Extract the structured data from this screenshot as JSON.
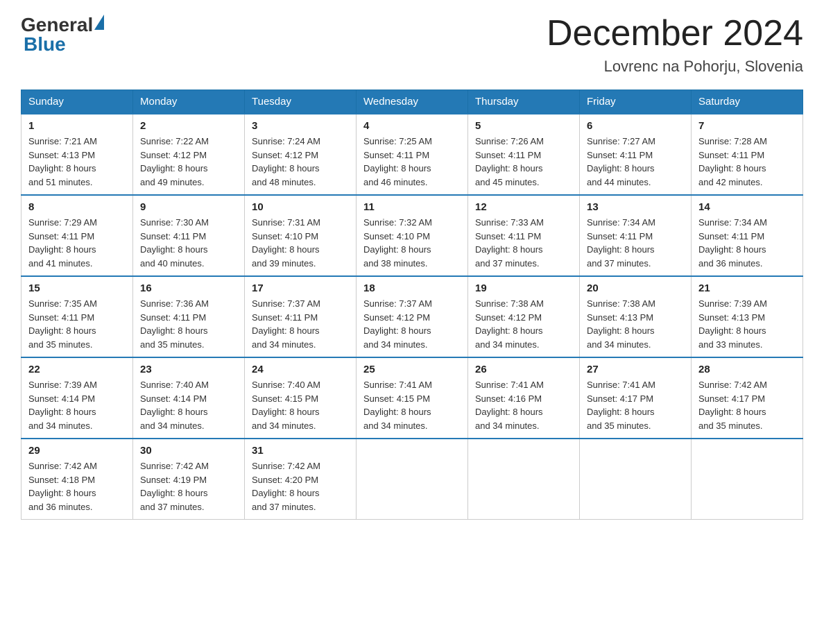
{
  "header": {
    "logo_general": "General",
    "logo_blue": "Blue",
    "title": "December 2024",
    "subtitle": "Lovrenc na Pohorju, Slovenia"
  },
  "days_of_week": [
    "Sunday",
    "Monday",
    "Tuesday",
    "Wednesday",
    "Thursday",
    "Friday",
    "Saturday"
  ],
  "weeks": [
    [
      {
        "day": "1",
        "sunrise": "7:21 AM",
        "sunset": "4:13 PM",
        "daylight": "8 hours and 51 minutes."
      },
      {
        "day": "2",
        "sunrise": "7:22 AM",
        "sunset": "4:12 PM",
        "daylight": "8 hours and 49 minutes."
      },
      {
        "day": "3",
        "sunrise": "7:24 AM",
        "sunset": "4:12 PM",
        "daylight": "8 hours and 48 minutes."
      },
      {
        "day": "4",
        "sunrise": "7:25 AM",
        "sunset": "4:11 PM",
        "daylight": "8 hours and 46 minutes."
      },
      {
        "day": "5",
        "sunrise": "7:26 AM",
        "sunset": "4:11 PM",
        "daylight": "8 hours and 45 minutes."
      },
      {
        "day": "6",
        "sunrise": "7:27 AM",
        "sunset": "4:11 PM",
        "daylight": "8 hours and 44 minutes."
      },
      {
        "day": "7",
        "sunrise": "7:28 AM",
        "sunset": "4:11 PM",
        "daylight": "8 hours and 42 minutes."
      }
    ],
    [
      {
        "day": "8",
        "sunrise": "7:29 AM",
        "sunset": "4:11 PM",
        "daylight": "8 hours and 41 minutes."
      },
      {
        "day": "9",
        "sunrise": "7:30 AM",
        "sunset": "4:11 PM",
        "daylight": "8 hours and 40 minutes."
      },
      {
        "day": "10",
        "sunrise": "7:31 AM",
        "sunset": "4:10 PM",
        "daylight": "8 hours and 39 minutes."
      },
      {
        "day": "11",
        "sunrise": "7:32 AM",
        "sunset": "4:10 PM",
        "daylight": "8 hours and 38 minutes."
      },
      {
        "day": "12",
        "sunrise": "7:33 AM",
        "sunset": "4:11 PM",
        "daylight": "8 hours and 37 minutes."
      },
      {
        "day": "13",
        "sunrise": "7:34 AM",
        "sunset": "4:11 PM",
        "daylight": "8 hours and 37 minutes."
      },
      {
        "day": "14",
        "sunrise": "7:34 AM",
        "sunset": "4:11 PM",
        "daylight": "8 hours and 36 minutes."
      }
    ],
    [
      {
        "day": "15",
        "sunrise": "7:35 AM",
        "sunset": "4:11 PM",
        "daylight": "8 hours and 35 minutes."
      },
      {
        "day": "16",
        "sunrise": "7:36 AM",
        "sunset": "4:11 PM",
        "daylight": "8 hours and 35 minutes."
      },
      {
        "day": "17",
        "sunrise": "7:37 AM",
        "sunset": "4:11 PM",
        "daylight": "8 hours and 34 minutes."
      },
      {
        "day": "18",
        "sunrise": "7:37 AM",
        "sunset": "4:12 PM",
        "daylight": "8 hours and 34 minutes."
      },
      {
        "day": "19",
        "sunrise": "7:38 AM",
        "sunset": "4:12 PM",
        "daylight": "8 hours and 34 minutes."
      },
      {
        "day": "20",
        "sunrise": "7:38 AM",
        "sunset": "4:13 PM",
        "daylight": "8 hours and 34 minutes."
      },
      {
        "day": "21",
        "sunrise": "7:39 AM",
        "sunset": "4:13 PM",
        "daylight": "8 hours and 33 minutes."
      }
    ],
    [
      {
        "day": "22",
        "sunrise": "7:39 AM",
        "sunset": "4:14 PM",
        "daylight": "8 hours and 34 minutes."
      },
      {
        "day": "23",
        "sunrise": "7:40 AM",
        "sunset": "4:14 PM",
        "daylight": "8 hours and 34 minutes."
      },
      {
        "day": "24",
        "sunrise": "7:40 AM",
        "sunset": "4:15 PM",
        "daylight": "8 hours and 34 minutes."
      },
      {
        "day": "25",
        "sunrise": "7:41 AM",
        "sunset": "4:15 PM",
        "daylight": "8 hours and 34 minutes."
      },
      {
        "day": "26",
        "sunrise": "7:41 AM",
        "sunset": "4:16 PM",
        "daylight": "8 hours and 34 minutes."
      },
      {
        "day": "27",
        "sunrise": "7:41 AM",
        "sunset": "4:17 PM",
        "daylight": "8 hours and 35 minutes."
      },
      {
        "day": "28",
        "sunrise": "7:42 AM",
        "sunset": "4:17 PM",
        "daylight": "8 hours and 35 minutes."
      }
    ],
    [
      {
        "day": "29",
        "sunrise": "7:42 AM",
        "sunset": "4:18 PM",
        "daylight": "8 hours and 36 minutes."
      },
      {
        "day": "30",
        "sunrise": "7:42 AM",
        "sunset": "4:19 PM",
        "daylight": "8 hours and 37 minutes."
      },
      {
        "day": "31",
        "sunrise": "7:42 AM",
        "sunset": "4:20 PM",
        "daylight": "8 hours and 37 minutes."
      },
      null,
      null,
      null,
      null
    ]
  ],
  "labels": {
    "sunrise": "Sunrise:",
    "sunset": "Sunset:",
    "daylight": "Daylight:"
  },
  "accent_color": "#2479b5"
}
